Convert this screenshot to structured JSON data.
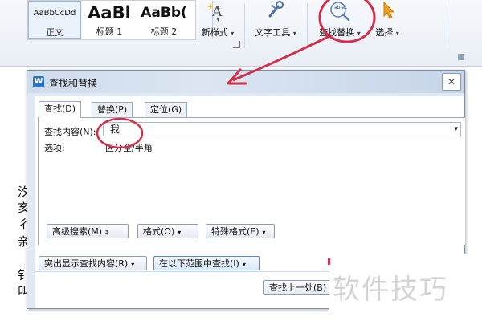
{
  "ribbon": {
    "styles": [
      {
        "sample": "AaBbCcDd",
        "label": "正文"
      },
      {
        "sample": "AaBl",
        "label": "标题 1"
      },
      {
        "sample": "AaBb(",
        "label": "标题 2"
      }
    ],
    "new_style_label": "新样式",
    "text_tools_label": "文字工具",
    "find_replace_label": "查找替换",
    "select_label": "选择",
    "caret": "▾",
    "find_replace_icon_text": "ab ac",
    "accent_color": "#2b73c6"
  },
  "left_fragments": [
    "汐",
    "亥",
    "彳",
    "亲",
    "钅",
    "叫"
  ],
  "dialog": {
    "title": "查找和替换",
    "close_glyph": "✕",
    "tabs": [
      "查找(D)",
      "替换(P)",
      "定位(G)"
    ],
    "active_tab": "查找(D)",
    "find_label": "查找内容(N):",
    "find_value": "我",
    "options_label": "选项:",
    "options_value": "区分全/半角",
    "buttons": {
      "advanced_search": "高级搜索(M)",
      "format": "格式(O)",
      "special_format": "特殊格式(E)",
      "highlight_all": "突出显示查找内容(R)",
      "find_in": "在以下范围中查找(I)",
      "find_previous": "查找上一处(B)"
    },
    "advanced_caret": "‡",
    "dropdown_caret": "▾"
  },
  "watermark": "软件技巧",
  "annotation_color": "#d0304a"
}
